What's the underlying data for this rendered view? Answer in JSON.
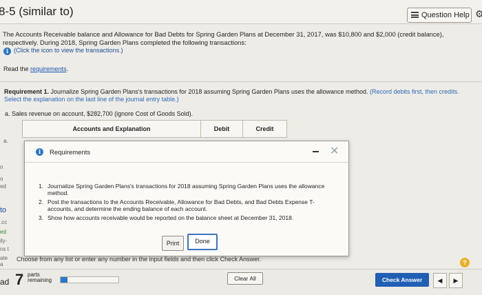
{
  "header": {
    "title": "8-5 (similar to)",
    "question_help": "Question Help"
  },
  "problem": {
    "statement": "The Accounts Receivable balance and Allowance for Bad Debts for Spring Garden Plans at December 31, 2017, was $10,800 and $2,000 (credit balance), respectively. During 2018, Spring Garden Plans completed the following transactions:",
    "click_icon_text": "(Click the icon to view the transactions.)",
    "read_prefix": "Read the ",
    "read_link": "requirements"
  },
  "requirement": {
    "label": "Requirement 1.",
    "text": " Journalize Spring Garden Plans's transactions for 2018 assuming Spring Garden Plans uses the allowance method. ",
    "note": "(Record debits first, then credits. Select the explanation on the last line of the journal entry table.)",
    "sales_line": "a. Sales revenue on account, $282,700 (ignore Cost of Goods Sold)."
  },
  "journal_table": {
    "headers": [
      "Accounts and Explanation",
      "Debit",
      "Credit"
    ],
    "row_label": "a."
  },
  "left_strip": [
    "n",
    "o",
    "ed",
    "to",
    ".cc",
    "ed",
    "ily-",
    "ns t",
    "ate a"
  ],
  "modal": {
    "title": "Requirements",
    "items": [
      {
        "num": "1.",
        "text": "Journalize Spring Garden Plans's transactions for 2018 assuming Spring Garden Plans uses the allowance method."
      },
      {
        "num": "2.",
        "text": "Post the transactions to the Accounts Receivable, Allowance for Bad Debts, and Bad Debts Expense T-accounts, and determine the ending balance of each account."
      },
      {
        "num": "3.",
        "text": "Show how accounts receivable would be reported on the balance sheet at December 31, 2018."
      }
    ],
    "print_label": "Print",
    "done_label": "Done"
  },
  "footer": {
    "instruction": "Choose from any list or enter any number in the input fields and then click Check Answer.",
    "help_label": "?",
    "left_cut": "ad",
    "parts_number": "7",
    "parts_word": "parts",
    "remaining_word": "remaining",
    "progress_fraction": 0.12,
    "clear_all": "Clear All",
    "check_answer": "Check Answer",
    "prev_symbol": "◀",
    "next_symbol": "▶"
  },
  "colors": {
    "accent": "#1f5fb4",
    "info": "#2a78c8",
    "help": "#e9b12a"
  }
}
